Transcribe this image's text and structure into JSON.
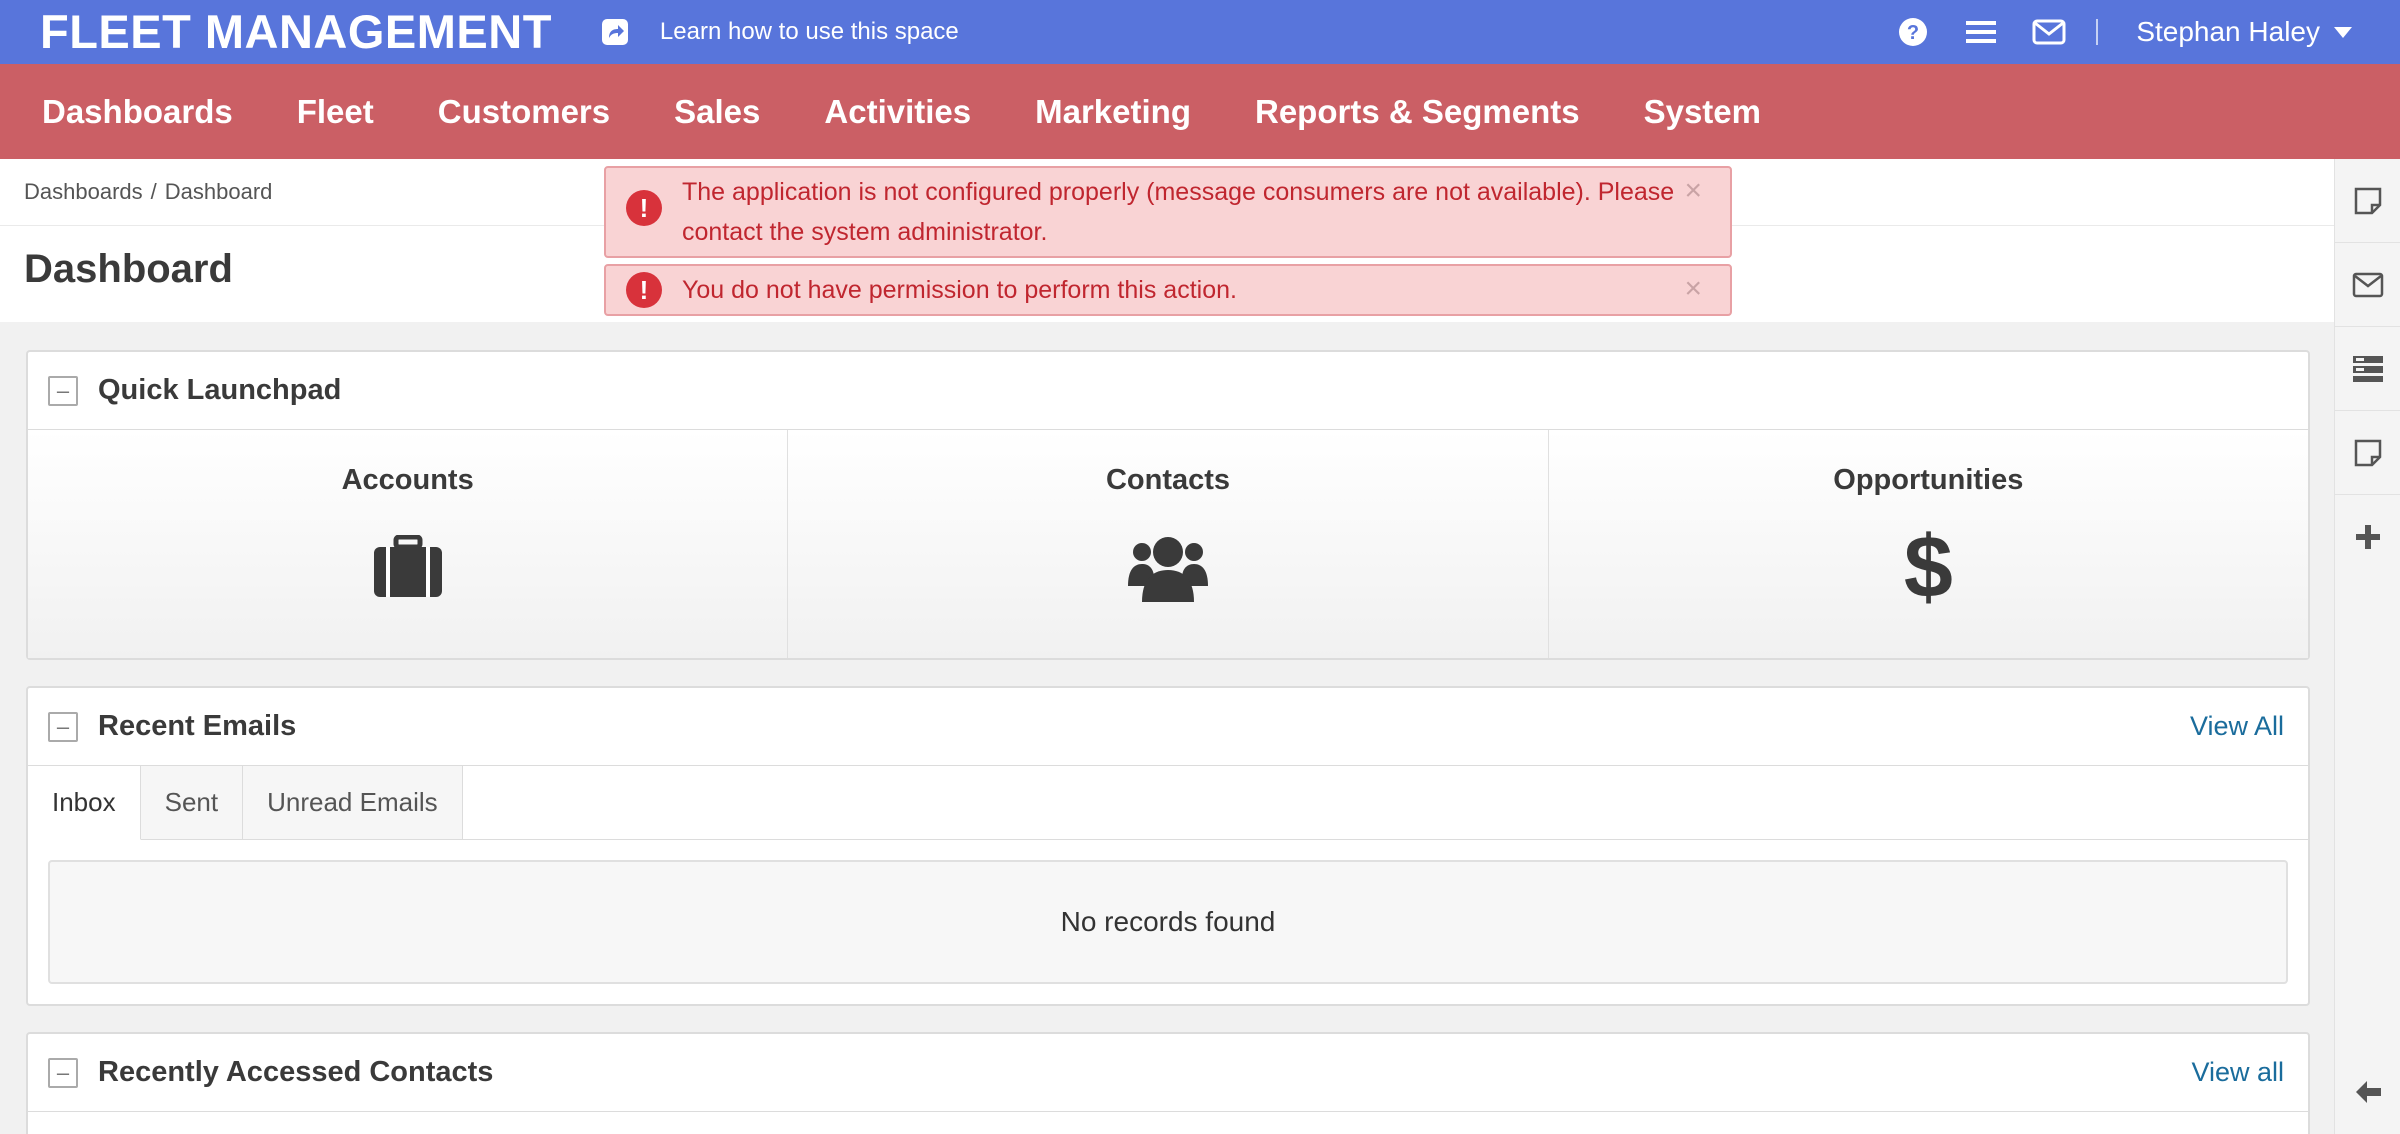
{
  "topbar": {
    "brand": "FLEET MANAGEMENT",
    "learn_link": "Learn how to use this space",
    "user_name": "Stephan Haley",
    "bg_color": "#5875db"
  },
  "nav": {
    "bg_color": "#cb5f65",
    "items": [
      {
        "label": "Dashboards"
      },
      {
        "label": "Fleet"
      },
      {
        "label": "Customers"
      },
      {
        "label": "Sales"
      },
      {
        "label": "Activities"
      },
      {
        "label": "Marketing"
      },
      {
        "label": "Reports & Segments"
      },
      {
        "label": "System"
      }
    ]
  },
  "breadcrumb": {
    "items": [
      "Dashboards",
      "Dashboard"
    ],
    "separator": "/"
  },
  "page": {
    "title": "Dashboard"
  },
  "alerts": [
    {
      "text": "The application is not configured properly (message consumers are not available). Please contact the system administrator.",
      "close": "×"
    },
    {
      "text": "You do not have permission to perform this action.",
      "close": "×"
    }
  ],
  "widgets": {
    "launchpad": {
      "title": "Quick Launchpad",
      "items": [
        {
          "label": "Accounts",
          "icon": "briefcase-icon"
        },
        {
          "label": "Contacts",
          "icon": "users-icon"
        },
        {
          "label": "Opportunities",
          "icon": "dollar-icon",
          "glyph": "$"
        }
      ]
    },
    "emails": {
      "title": "Recent Emails",
      "link": "View All",
      "tabs": [
        "Inbox",
        "Sent",
        "Unread Emails"
      ],
      "active_tab": "Inbox",
      "empty_text": "No records found"
    },
    "contacts": {
      "title": "Recently Accessed Contacts",
      "link": "View all"
    }
  },
  "collapse_symbol": "–",
  "accent_link_color": "#1a6c9c",
  "alert_color": "#c0262f"
}
